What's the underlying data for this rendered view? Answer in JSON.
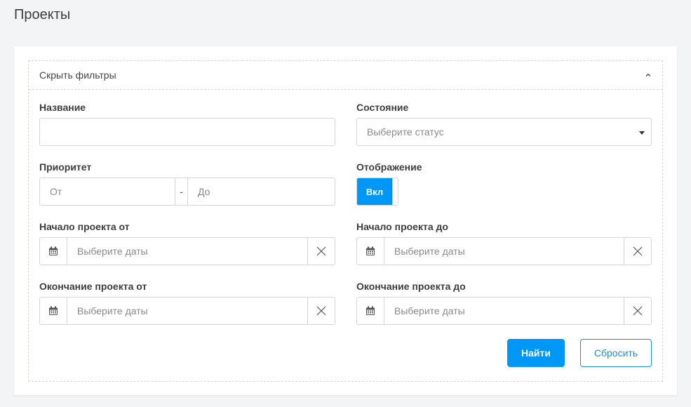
{
  "page": {
    "title": "Проекты"
  },
  "filters": {
    "toggle_label": "Скрыть фильтры",
    "name": {
      "label": "Название",
      "value": ""
    },
    "state": {
      "label": "Состояние",
      "placeholder": "Выберите статус"
    },
    "priority": {
      "label": "Приоритет",
      "from_placeholder": "От",
      "separator": "-",
      "to_placeholder": "До"
    },
    "display": {
      "label": "Отображение",
      "toggle_on_label": "Вкл"
    },
    "start_from": {
      "label": "Начало проекта от",
      "placeholder": "Выберите даты"
    },
    "start_to": {
      "label": "Начало проекта до",
      "placeholder": "Выберите даты"
    },
    "end_from": {
      "label": "Окончание проекта от",
      "placeholder": "Выберите даты"
    },
    "end_to": {
      "label": "Окончание проекта до",
      "placeholder": "Выберите даты"
    },
    "search_button": "Найти",
    "reset_button": "Сбросить"
  },
  "colors": {
    "accent": "#0097f6",
    "outline": "#1b8fd6",
    "background": "#f3f4f6"
  },
  "icons": {
    "collapse": "chevron-up-icon",
    "dropdown": "caret-down-icon",
    "calendar": "calendar-icon",
    "clear": "close-icon"
  }
}
